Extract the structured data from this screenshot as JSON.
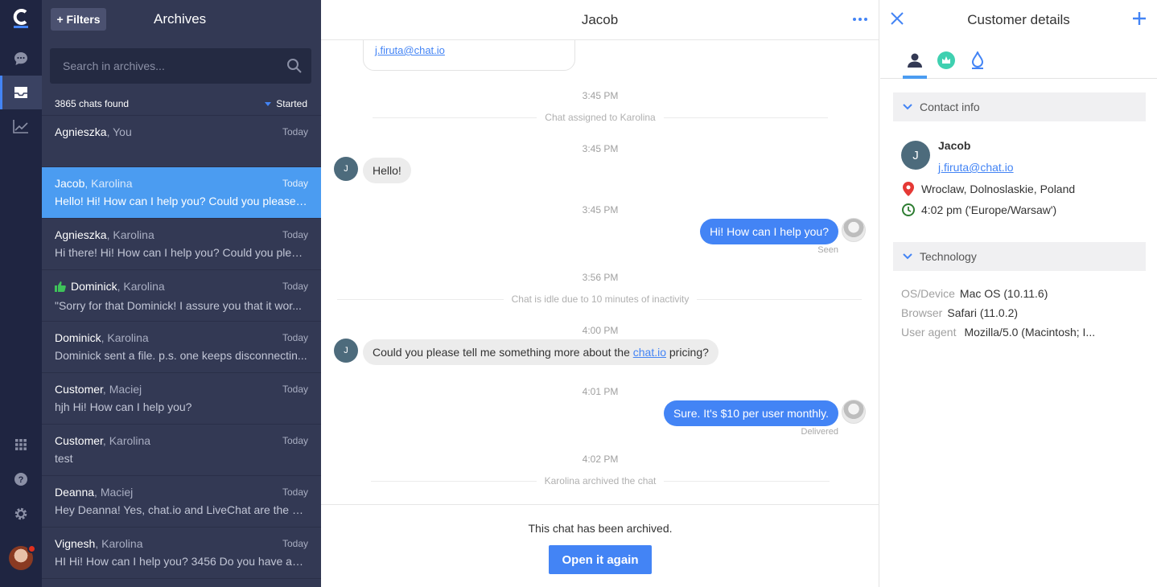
{
  "colors": {
    "accent": "#4384f5",
    "rail": "#1f2541",
    "list_bg": "#333954",
    "selected": "#4b9cf1"
  },
  "archives": {
    "filters_label": "+ Filters",
    "title": "Archives",
    "search_placeholder": "Search in archives...",
    "found": "3865 chats found",
    "sort_label": "Started",
    "items": [
      {
        "customer": "Agnieszka",
        "agent": ", You",
        "date": "Today",
        "preview": "",
        "selected": false,
        "rated": false
      },
      {
        "customer": "Jacob",
        "agent": ", Karolina",
        "date": "Today",
        "preview": "Hello! Hi! How can I help you? Could you please t...",
        "selected": true,
        "rated": false
      },
      {
        "customer": "Agnieszka",
        "agent": ", Karolina",
        "date": "Today",
        "preview": "Hi there! Hi! How can I help you? Could you pleas...",
        "selected": false,
        "rated": false
      },
      {
        "customer": "Dominick",
        "agent": ", Karolina",
        "date": "Today",
        "preview": "\"Sorry for that Dominick! I assure you that it wor...",
        "selected": false,
        "rated": true
      },
      {
        "customer": "Dominick",
        "agent": ", Karolina",
        "date": "Today",
        "preview": "Dominick sent a file. p.s. one keeps disconnectin...",
        "selected": false,
        "rated": false
      },
      {
        "customer": "Customer",
        "agent": ", Maciej",
        "date": "Today",
        "preview": "hjh Hi! How can I help you?",
        "selected": false,
        "rated": false
      },
      {
        "customer": "Customer",
        "agent": ", Karolina",
        "date": "Today",
        "preview": "test",
        "selected": false,
        "rated": false
      },
      {
        "customer": "Deanna",
        "agent": ", Maciej",
        "date": "Today",
        "preview": "Hey Deanna! Yes, chat.io and LiveChat are the sa...",
        "selected": false,
        "rated": false
      },
      {
        "customer": "Vignesh",
        "agent": ", Karolina",
        "date": "Today",
        "preview": "HI Hi! How can I help you? 3456 Do you have any...",
        "selected": false,
        "rated": false
      }
    ]
  },
  "chat": {
    "title": "Jacob",
    "email_link": "j.firuta@chat.io",
    "customer_initial": "J",
    "times": [
      "3:45 PM",
      "3:45 PM",
      "3:45 PM",
      "3:56 PM",
      "4:00 PM",
      "4:01 PM",
      "4:02 PM"
    ],
    "sys_assigned": "Chat assigned to Karolina",
    "sys_idle": "Chat is idle due to 10 minutes of inactivity",
    "sys_archived": "Karolina archived the chat",
    "msg_hello": "Hello!",
    "msg_help": "Hi! How can I help you?",
    "status_seen": "Seen",
    "msg_pricing_pre": "Could you please tell me something more about the ",
    "msg_pricing_link": "chat.io",
    "msg_pricing_post": " pricing?",
    "msg_price": "Sure. It's $10 per user monthly.",
    "status_delivered": "Delivered",
    "archived_note": "This chat has been archived.",
    "reopen_label": "Open it again"
  },
  "details": {
    "title": "Customer details",
    "contact_section": "Contact info",
    "name": "Jacob",
    "initial": "J",
    "email": "j.firuta@chat.io",
    "location": "Wroclaw, Dolnoslaskie, Poland",
    "local_time": "4:02 pm ('Europe/Warsaw')",
    "tech_section": "Technology",
    "tech": [
      {
        "k": "OS/Device",
        "v": "Mac OS (10.11.6)"
      },
      {
        "k": "Browser",
        "v": "Safari (11.0.2)"
      },
      {
        "k": "User agent",
        "v": "Mozilla/5.0 (Macintosh; I..."
      }
    ]
  }
}
